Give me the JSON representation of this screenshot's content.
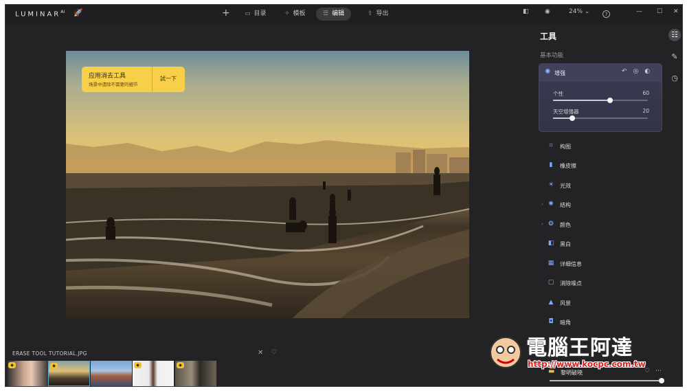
{
  "app": {
    "logo": "LUMINAR",
    "logo_sup": "AI"
  },
  "topbar": {
    "add_label": "+",
    "nav": [
      {
        "label": "目录"
      },
      {
        "label": "模板"
      },
      {
        "label": "编辑"
      },
      {
        "label": "导出"
      }
    ],
    "zoom": "24%"
  },
  "toast": {
    "title": "应用消去工具",
    "subtitle": "场景中遗除不需要的细节",
    "button": "試一下"
  },
  "filmstrip": {
    "file_name": "ERASE TOOL TUTORIAL.JPG"
  },
  "panel": {
    "title": "工具",
    "section": "基本功能",
    "card": {
      "label": "增强",
      "sliders": [
        {
          "label": "个性",
          "value": "60",
          "level": 0.6
        },
        {
          "label": "天空增强器",
          "value": "20",
          "level": 0.2
        }
      ]
    },
    "tools": [
      {
        "label": "构图"
      },
      {
        "label": "橡皮擦"
      },
      {
        "label": "光效"
      },
      {
        "label": "结构"
      },
      {
        "label": "颜色"
      },
      {
        "label": "黑白"
      },
      {
        "label": "详细信息"
      },
      {
        "label": "消除噪点"
      },
      {
        "label": "风景"
      },
      {
        "label": "暗角"
      }
    ],
    "preset": {
      "label": "黎明破晓",
      "level": 0.98
    }
  },
  "watermark": {
    "text": "電腦王阿達",
    "url": "http://www.kocpc.com.tw"
  }
}
